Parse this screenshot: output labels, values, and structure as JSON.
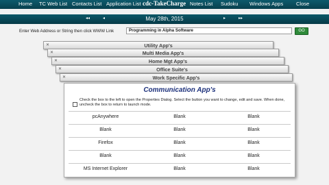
{
  "nav": {
    "items": [
      "Home",
      "TC Web List",
      "Contacts List",
      "Application List",
      "cdc-TakeCharge",
      "Notes List",
      "Sudoku",
      "Windows Apps",
      "Close"
    ]
  },
  "date_bar": {
    "date": "May 28th, 2015",
    "prev_year": "◂◂",
    "prev_month": "◂",
    "next_month": "▸",
    "next_year": "▸▸"
  },
  "address": {
    "label": "Enter Web Address or String then click WWW Link",
    "value": "Programming in Alpha Software",
    "go_label": "GO"
  },
  "tabs": [
    "Utility App's",
    "Multi Media App's",
    "Home Mgt App's",
    "Office Suite's",
    "Work Specific App's"
  ],
  "panel": {
    "title": "Communication App's",
    "instructions": "Check the box to the left to open the Properties Dialog. Select the button you want to change, edit and save. When done, uncheck the box to return to launch mode.",
    "rows": [
      [
        "pcAnywhere",
        "Blank",
        "Blank"
      ],
      [
        "Blank",
        "Blank",
        "Blank"
      ],
      [
        "Firefox",
        "Blank",
        "Blank"
      ],
      [
        "Blank",
        "Blank",
        "Blank"
      ],
      [
        "MS Internet Explorer",
        "Blank",
        "Blank"
      ]
    ]
  },
  "colors": {
    "header_bg": "#0a4f5f",
    "title_text": "#1b2f7a",
    "go_button": "#2f8a3a"
  }
}
